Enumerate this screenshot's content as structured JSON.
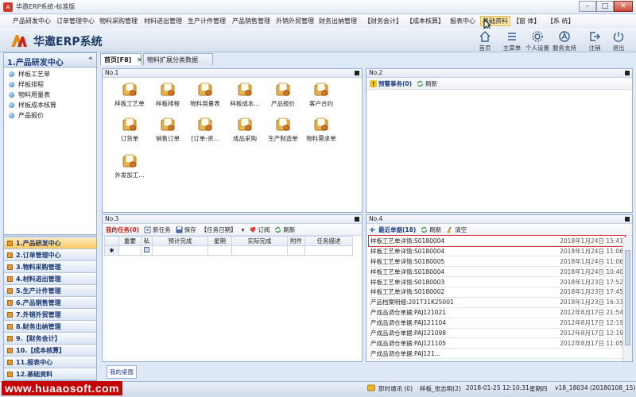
{
  "window": {
    "title": "华邀ERP系统-标准版",
    "min": "–",
    "max": "□",
    "close": "✕"
  },
  "menu": [
    {
      "label": "产品研发中心"
    },
    {
      "label": "订单管理中心"
    },
    {
      "label": "物料采购管理"
    },
    {
      "label": "材料进出管理"
    },
    {
      "label": "生产计件管理"
    },
    {
      "label": "产品销售管理"
    },
    {
      "label": "外销外贸管理"
    },
    {
      "label": "财务出纳管理"
    },
    {
      "label": "【财务会计】"
    },
    {
      "label": "【成本核算】"
    },
    {
      "label": "报表中心"
    },
    {
      "label": "基础资料"
    },
    {
      "label": "【窗 体】"
    },
    {
      "label": "【系 统】"
    }
  ],
  "brand": {
    "name": "华邀ERP系统"
  },
  "toolbar": [
    {
      "label": "首页",
      "icon": "home-icon"
    },
    {
      "label": "主菜单",
      "icon": "menu-icon"
    },
    {
      "label": "个人设置",
      "icon": "gear-icon"
    },
    {
      "label": "服务支持",
      "icon": "support-icon"
    },
    {
      "label": "注销",
      "icon": "logout-icon"
    },
    {
      "label": "退出",
      "icon": "power-icon"
    }
  ],
  "sidebar": {
    "title": "1.产品研发中心",
    "items": [
      {
        "label": "样板工艺单"
      },
      {
        "label": "样板排程"
      },
      {
        "label": "物料用量表"
      },
      {
        "label": "样板成本核算"
      },
      {
        "label": "产品报价"
      }
    ],
    "categories": [
      {
        "label": "1.产品研发中心"
      },
      {
        "label": "2.订单管理中心"
      },
      {
        "label": "3.物料采购管理"
      },
      {
        "label": "4.材料进出管理"
      },
      {
        "label": "5.生产计件管理"
      },
      {
        "label": "6.产品销售管理"
      },
      {
        "label": "7.外销外贸管理"
      },
      {
        "label": "8.财务出纳管理"
      },
      {
        "label": "9.【财务会计】"
      },
      {
        "label": "10.【成本核算】"
      },
      {
        "label": "11.报表中心"
      },
      {
        "label": "12.基础资料"
      }
    ]
  },
  "tabs": [
    {
      "label": "首页[F8]"
    },
    {
      "label": "物料扩展分类数据"
    }
  ],
  "panel1": {
    "title": "No.1",
    "apps": [
      {
        "label": "样板工艺单"
      },
      {
        "label": "样板排程"
      },
      {
        "label": "物料用量表"
      },
      {
        "label": "样板成本..."
      },
      {
        "label": "产品报价"
      },
      {
        "label": "客户合约"
      },
      {
        "label": "订货单"
      },
      {
        "label": "销售订单"
      },
      {
        "label": "[订单-资..."
      },
      {
        "label": "成品采购"
      },
      {
        "label": "生产制造单"
      },
      {
        "label": "物料需求单"
      },
      {
        "label": "外发加工..."
      }
    ]
  },
  "panel2": {
    "title": "No.2",
    "warn": "预警事务(0)",
    "refresh": "刷新"
  },
  "panel3": {
    "title": "No.3",
    "tool": {
      "my": "我的任务(0)",
      "new": "新任务",
      "save": "保存",
      "date": "【任务日期】",
      "sub": "订阅",
      "refresh": "刷新"
    },
    "cols": [
      "重要",
      "私",
      "预计完成",
      "星期",
      "实际完成",
      "附件",
      "任务描述"
    ],
    "newrow": "✱"
  },
  "panel4": {
    "title": "No.4",
    "tool": {
      "recent": "最近单据(18)",
      "refresh": "刷新",
      "clear": "清空"
    },
    "rows": [
      {
        "name": "样板工艺单详情:S0180004",
        "time": "2018年1月24日  15:41"
      },
      {
        "name": "样板工艺单详情:S0180004",
        "time": "2018年1月24日  11:06"
      },
      {
        "name": "样板工艺单详情:S0180005",
        "time": "2018年1月24日  11:06"
      },
      {
        "name": "样板工艺单详情:S0180004",
        "time": "2018年1月24日  10:40"
      },
      {
        "name": "样板工艺单详情:S0180003",
        "time": "2018年1月23日  17:52"
      },
      {
        "name": "样板工艺单详情:S0180002",
        "time": "2018年1月23日  17:45"
      },
      {
        "name": "产品档案明细:201T31K25001",
        "time": "2018年1月23日  16:33"
      },
      {
        "name": "产成品调仓单据:PAJ121021",
        "time": "2012年8月17日  21:54"
      },
      {
        "name": "产成品调仓单据:PAJ121104",
        "time": "2012年8月17日  12:19"
      },
      {
        "name": "产成品调仓单据:PAJ121098",
        "time": "2012年8月17日  12:19"
      },
      {
        "name": "产成品调仓单据:PAJ121105",
        "time": "2012年8月17日  11:05"
      },
      {
        "name": "产成品调仓单据:PAJ121...",
        "time": ""
      }
    ]
  },
  "desk_tab": "我的桌面",
  "status": {
    "watermark": "www.huaaosoft.com",
    "im": "即时通讯 (0)",
    "user": "样板_张志明(2)",
    "datetime": "2018-01-25  12:10:31",
    "weekday": "星期四",
    "version": "v18_18034 (20180108_15)"
  }
}
